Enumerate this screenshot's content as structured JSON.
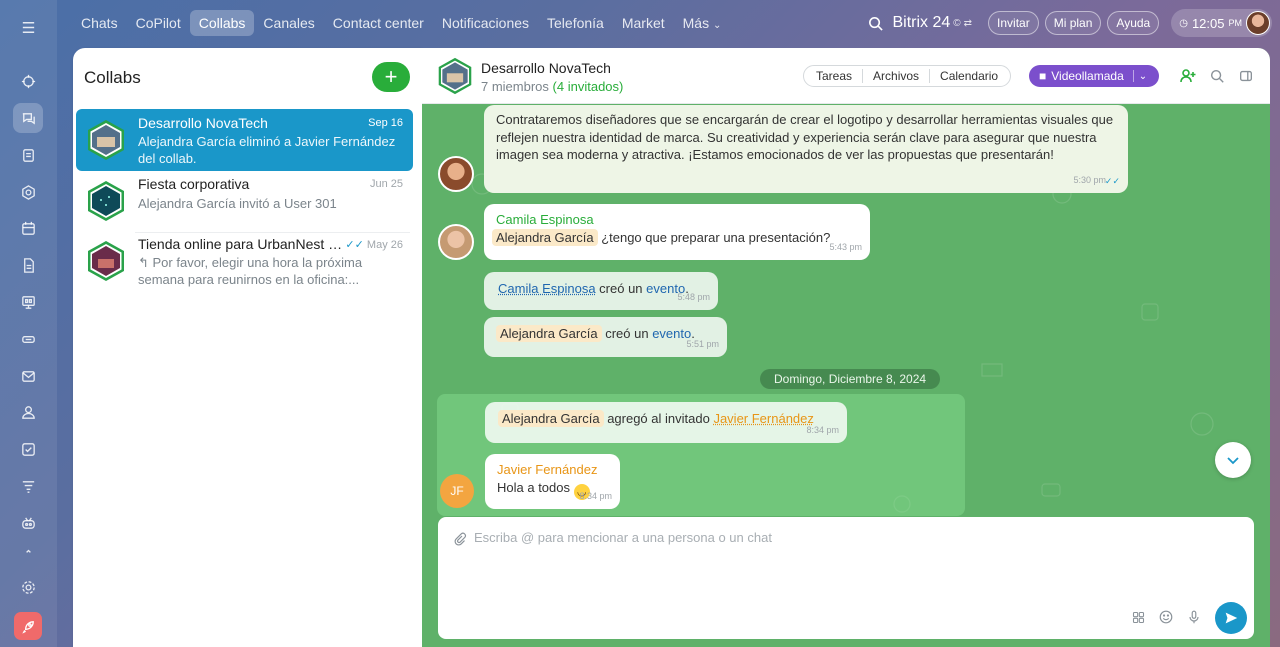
{
  "topnav": {
    "items": [
      "Chats",
      "CoPilot",
      "Collabs",
      "Canales",
      "Contact center",
      "Notificaciones",
      "Telefonía",
      "Market",
      "Más"
    ],
    "active": "Collabs"
  },
  "header_right": {
    "brand": "Bitrix 24",
    "brand_sup": "©",
    "invite": "Invitar",
    "plan": "Mi plan",
    "help": "Ayuda",
    "clock_time": "12:05",
    "clock_ampm": "PM"
  },
  "sidebar": {
    "title": "Collabs",
    "collabs": [
      {
        "title": "Desarrollo NovaTech",
        "date": "Sep 16",
        "message": "Alejandra García eliminó a Javier Fernández del collab."
      },
      {
        "title": "Fiesta corporativa",
        "date": "Jun 25",
        "message": "Alejandra García invitó a User 301"
      },
      {
        "title": "Tienda online para UrbanNest C...",
        "date": "May 26",
        "message": "Por favor, elegir una hora la próxima semana para reunirnos en la oficina:..."
      }
    ]
  },
  "chat": {
    "title": "Desarrollo NovaTech",
    "members": "7 miembros",
    "invited": "(4 invitados)",
    "tabs": [
      "Tareas",
      "Archivos",
      "Calendario"
    ],
    "video_label": "Videollamada",
    "messages": {
      "m1_text": "Contrataremos diseñadores que se encargarán de crear el logotipo y desarrollar herramientas visuales que reflejen nuestra identidad de marca. Su creatividad y experiencia serán clave para asegurar que nuestra imagen sea moderna y atractiva. ¡Estamos emocionados de ver las propuestas que presentarán!",
      "m1_time": "5:30 pm",
      "m2_author": "Camila Espinosa",
      "m2_mention": "Alejandra García",
      "m2_text": "¿tengo que preparar una presentación?",
      "m2_time": "5:43 pm",
      "m3_actor": "Camila Espinosa",
      "m3_text": "creó un",
      "m3_link": "evento",
      "m3_time": "5:48 pm",
      "m4_actor": "Alejandra García",
      "m4_text": "creó un",
      "m4_link": "evento",
      "m4_time": "5:51 pm",
      "date_sep": "Domingo, Diciembre 8, 2024",
      "m5_actor": "Alejandra García",
      "m5_text": "agregó al invitado",
      "m5_link": "Javier Fernández",
      "m5_time": "8:34 pm",
      "m6_author": "Javier Fernández",
      "m6_text": "Hola a todos",
      "m6_time": "8:34 pm",
      "m6_initials": "JF"
    },
    "composer_placeholder": "Escriba @ para mencionar a una persona o un chat"
  },
  "colors": {
    "accent_blue": "#1a97c9",
    "accent_green": "#29ad3a",
    "video_purple": "#7b4fcc",
    "chat_bg": "#5fb169"
  }
}
